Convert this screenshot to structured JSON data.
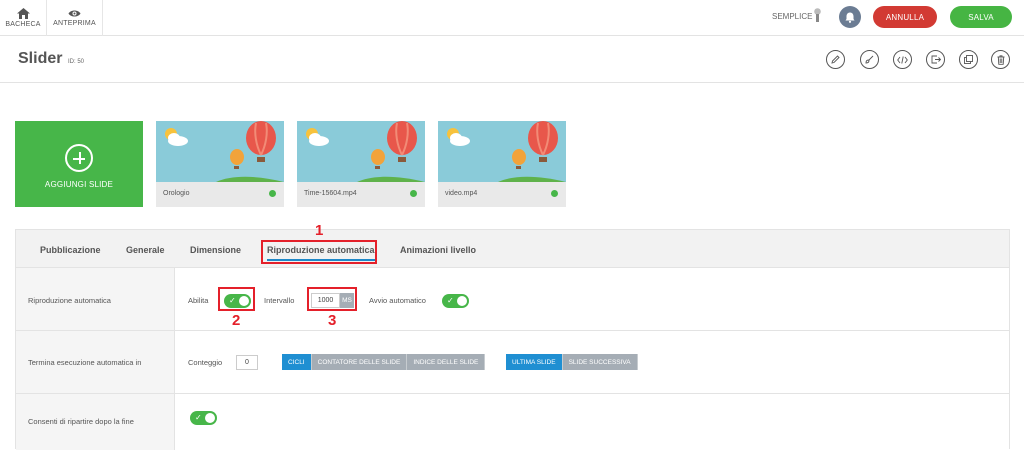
{
  "topbar": {
    "bacheca": "BACHECA",
    "anteprima": "ANTEPRIMA",
    "mode": "SEMPLICE",
    "annulla": "ANNULLA",
    "salva": "SALVA"
  },
  "header": {
    "title": "Slider",
    "id": "ID: 50"
  },
  "slides": {
    "add_label": "AGGIUNGI SLIDE",
    "items": [
      {
        "label": "Orologio"
      },
      {
        "label": "Time-15604.mp4"
      },
      {
        "label": "video.mp4"
      }
    ]
  },
  "tabs": [
    {
      "label": "Pubblicazione"
    },
    {
      "label": "Generale"
    },
    {
      "label": "Dimensione"
    },
    {
      "label": "Riproduzione automatica"
    },
    {
      "label": "Animazioni livello"
    }
  ],
  "annotations": [
    "1",
    "2",
    "3"
  ],
  "rows": {
    "autoplay": {
      "label": "Riproduzione automatica",
      "enable": "Abilita",
      "interval": "Intervallo",
      "interval_value": "1000",
      "interval_unit": "MS",
      "autostart": "Avvio automatico"
    },
    "stop": {
      "label": "Termina esecuzione automatica in",
      "count": "Conteggio",
      "count_value": "0",
      "seg1": [
        "CICLI",
        "CONTATORE DELLE SLIDE",
        "INDICE DELLE SLIDE"
      ],
      "seg2": [
        "ULTIMA SLIDE",
        "SLIDE SUCCESSIVA"
      ]
    },
    "restart": {
      "label": "Consenti di ripartire dopo la fine"
    }
  },
  "colors": {
    "green": "#47b649",
    "red": "#d23a33",
    "blue": "#1f8fd2",
    "annotation_red": "#e4202a"
  }
}
